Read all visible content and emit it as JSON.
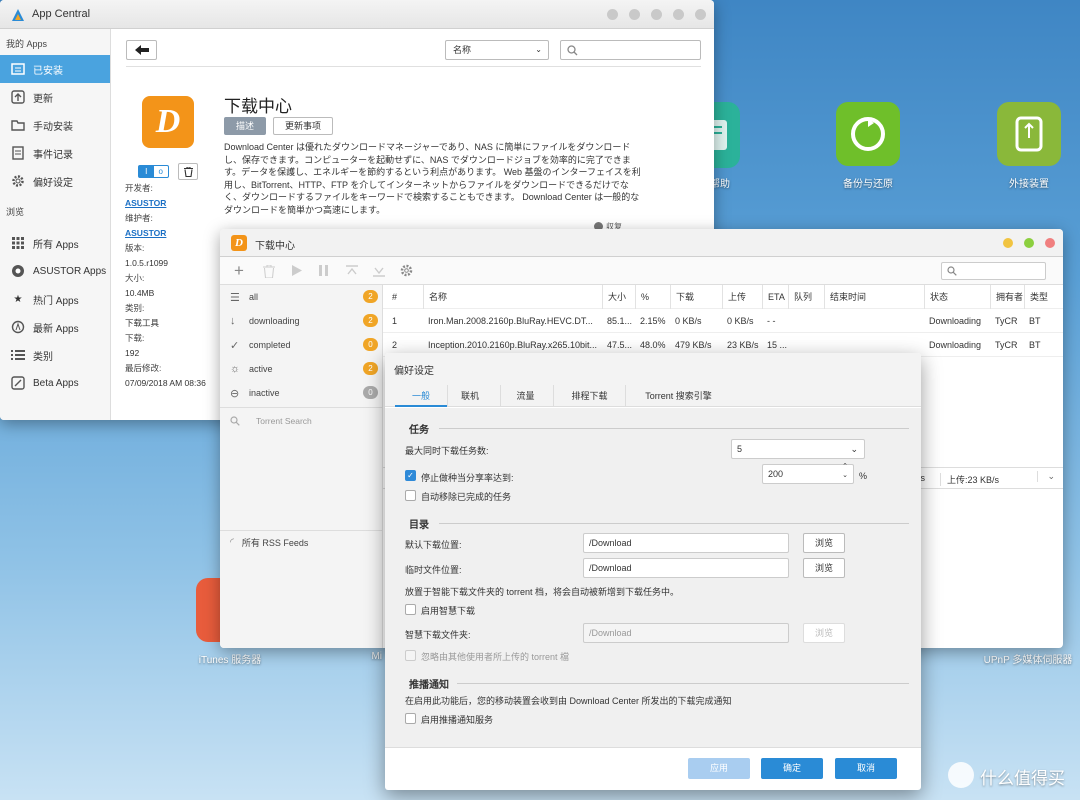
{
  "desktop": {
    "icons": [
      {
        "label": "帮助",
        "color": "#2bb29a"
      },
      {
        "label": "备份与还原",
        "color": "#6fbf2a"
      },
      {
        "label": "外接装置",
        "color": "#8ab83a"
      },
      {
        "label": "iTunes 服务器",
        "color": "#e85c3c"
      },
      {
        "label": "Mi",
        "color": ""
      },
      {
        "label": "UPnP 多媒体伺服器",
        "color": ""
      }
    ],
    "watermark": "什么值得买"
  },
  "app_central": {
    "title": "App Central",
    "sidebar": {
      "my_apps": "我的 Apps",
      "items": [
        {
          "label": "已安装",
          "icon": "installed-icon",
          "active": true
        },
        {
          "label": "更新",
          "icon": "update-icon"
        },
        {
          "label": "手动安装",
          "icon": "folder-icon"
        },
        {
          "label": "事件记录",
          "icon": "log-icon"
        },
        {
          "label": "偏好设定",
          "icon": "gear-icon"
        }
      ],
      "browse": "浏览",
      "browse_items": [
        {
          "label": "所有 Apps",
          "icon": "grid-icon"
        },
        {
          "label": "ASUSTOR Apps",
          "icon": "asustor-icon"
        },
        {
          "label": "热门 Apps",
          "icon": "star-icon"
        },
        {
          "label": "最新 Apps",
          "icon": "new-icon"
        },
        {
          "label": "类别",
          "icon": "list-icon"
        },
        {
          "label": "Beta Apps",
          "icon": "beta-icon"
        }
      ]
    },
    "sort_select": "名称",
    "search_placeholder": "",
    "app": {
      "name": "下载中心",
      "tab_desc": "描述",
      "tab_updates": "更新事项",
      "description": "Download Center は優れたダウンロードマネージャーであり、NAS に簡単にファイルをダウンロードし、保存できます。コンピューターを起動せずに、NAS でダウンロードジョブを効率的に完了できます。データを保護し、エネルギーを節約するという利点があります。 Web 基盤のインターフェイスを利用し、BitTorrent、HTTP、FTP を介してインターネットからファイルをダウンロードできるだけでなく、ダウンロードするファイルをキーワードで検索することもできます。 Download Center は一般的なダウンロードを簡単かつ高速にします。",
      "fold": "収复",
      "meta": [
        {
          "k": "开发者:",
          "v": "ASUSTOR",
          "link": true
        },
        {
          "k": "维护者:",
          "v": "ASUSTOR",
          "link": true
        },
        {
          "k": "版本:",
          "v": "1.0.5.r1099"
        },
        {
          "k": "大小:",
          "v": "10.4MB"
        },
        {
          "k": "类别:",
          "v": "下载工具"
        },
        {
          "k": "下载:",
          "v": "192"
        },
        {
          "k": "最后修改:",
          "v": "07/09/2018 AM 08:36"
        }
      ]
    }
  },
  "download_center": {
    "title": "下载中心",
    "filters": [
      {
        "label": "all",
        "count": "2",
        "icon": "list-icon"
      },
      {
        "label": "downloading",
        "count": "2",
        "icon": "arrow-down-icon"
      },
      {
        "label": "completed",
        "count": "0",
        "icon": "check-icon"
      },
      {
        "label": "active",
        "count": "2",
        "icon": "sun-icon"
      },
      {
        "label": "inactive",
        "count": "0",
        "icon": "minus-circle-icon"
      }
    ],
    "torrent_search": "Torrent Search",
    "rss": "所有 RSS Feeds",
    "columns": [
      "#",
      "名称",
      "大小",
      "%",
      "下载",
      "上传",
      "ETA",
      "队列",
      "结束时间",
      "状态",
      "拥有者",
      "类型"
    ],
    "rows": [
      [
        "1",
        "Iron.Man.2008.2160p.BluRay.HEVC.DT...",
        "85.1...",
        "2.15%",
        "0 KB/s",
        "0 KB/s",
        "- -",
        "",
        "",
        "Downloading",
        "TyCR",
        "BT"
      ],
      [
        "2",
        "Inception.2010.2160p.BluRay.x265.10bit...",
        "47.5...",
        "48.0%",
        "479 KB/s",
        "23 KB/s",
        "15 ...",
        "",
        "",
        "Downloading",
        "TyCR",
        "BT"
      ]
    ],
    "status_bar": {
      "down": "/s",
      "up": "上传:23 KB/s"
    }
  },
  "prefs": {
    "title": "偏好设定",
    "tabs": [
      "一般",
      "联机",
      "流量",
      "排程下载",
      "Torrent 搜索引擎"
    ],
    "task": {
      "header": "任务",
      "max_label": "最大同时下载任务数:",
      "max_value": "5",
      "ratio_label": "停止做种当分享率达到:",
      "ratio_value": "200",
      "ratio_unit": "%",
      "auto_remove": "自动移除已完成的任务"
    },
    "dir": {
      "header": "目录",
      "default_label": "默认下载位置:",
      "default_value": "/Download",
      "temp_label": "临时文件位置:",
      "temp_value": "/Download",
      "browse": "浏览",
      "smart_note": "放置于智能下载文件夹的 torrent 档，将会自动被新增到下载任务中。",
      "smart_enable": "启用智慧下载",
      "smart_label": "智慧下载文件夹:",
      "smart_value": "/Download",
      "ignore": "忽略由其他使用者所上传的 torrent 檔"
    },
    "push": {
      "header": "推播通知",
      "note": "在启用此功能后，您的移动装置会收到由 Download Center 所发出的下载完成通知",
      "enable": "启用推播通知服务"
    },
    "buttons": {
      "apply": "应用",
      "ok": "确定",
      "cancel": "取消"
    }
  }
}
